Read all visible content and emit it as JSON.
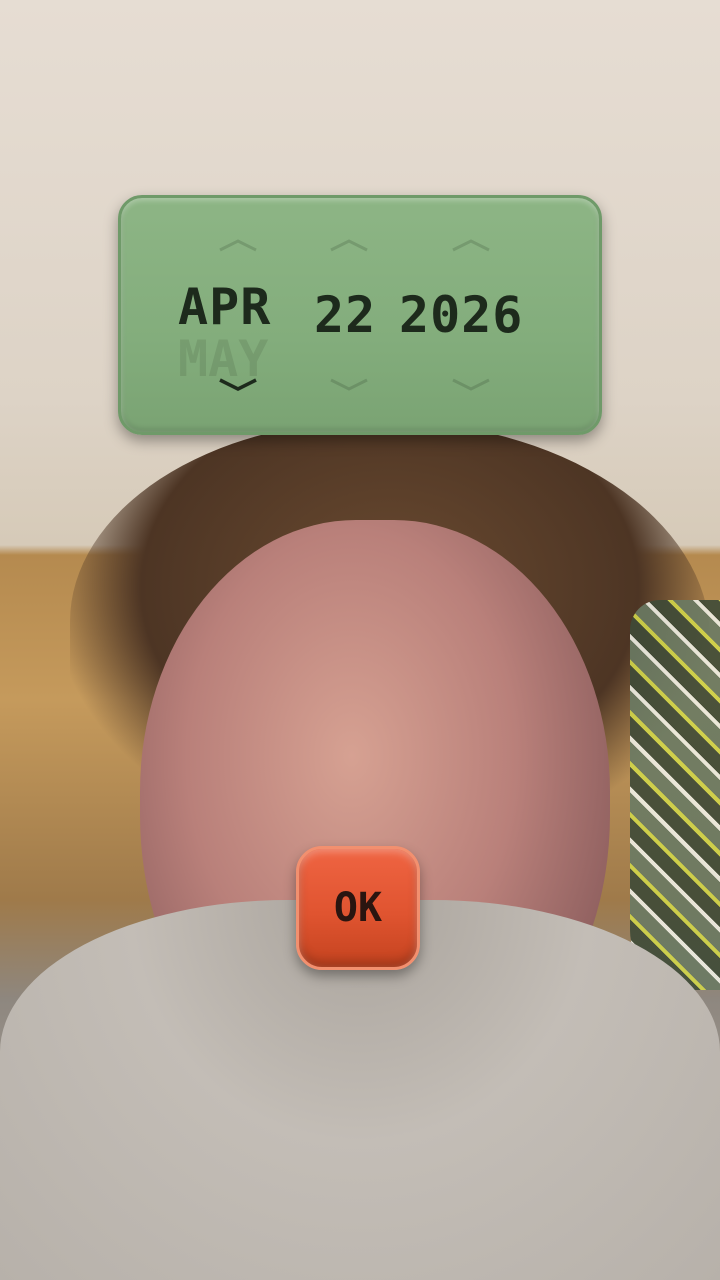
{
  "date_picker": {
    "month": "APR",
    "next_month_preview": "MAY",
    "day": "22",
    "year": "2026",
    "panel_color": "#86b07f",
    "text_color": "#1d2a1c"
  },
  "icons": {
    "month_up": "chevron-up-icon",
    "month_down": "chevron-down-icon",
    "day_up": "chevron-up-icon",
    "day_down": "chevron-down-icon",
    "year_up": "chevron-up-icon",
    "year_down": "chevron-down-icon"
  },
  "ok_button": {
    "label": "OK",
    "color": "#e05430"
  }
}
